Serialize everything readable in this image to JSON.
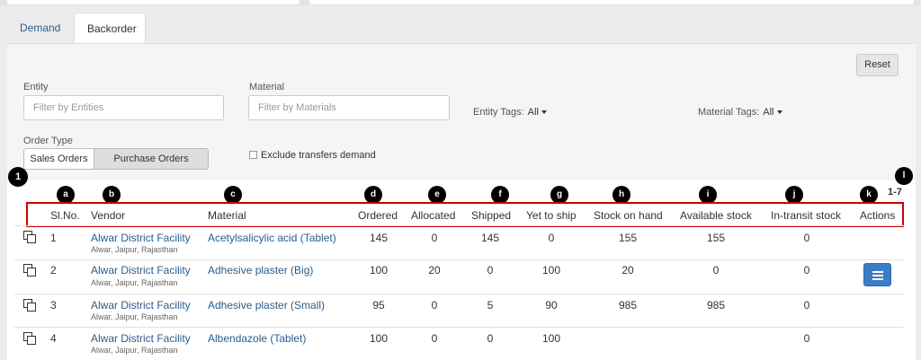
{
  "tabs": [
    {
      "label": "Demand"
    },
    {
      "label": "Backorder"
    }
  ],
  "filters": {
    "reset_label": "Reset",
    "entity_label": "Entity",
    "entity_placeholder": "Filter by Entities",
    "material_label": "Material",
    "material_placeholder": "Filter by Materials",
    "entity_tags_label": "Entity Tags:",
    "entity_tags_value": "All",
    "material_tags_label": "Material Tags:",
    "material_tags_value": "All",
    "order_type_label": "Order Type",
    "order_types": [
      "Sales Orders",
      "Purchase Orders"
    ],
    "exclude_transfers_label": "Exclude transfers demand"
  },
  "pagination": "1-7",
  "callouts": {
    "one": "1",
    "a": "a",
    "b": "b",
    "c": "c",
    "d": "d",
    "e": "e",
    "f": "f",
    "g": "g",
    "h": "h",
    "i": "i",
    "j": "j",
    "k": "k",
    "l": "l"
  },
  "table": {
    "columns": [
      "Sl.No.",
      "Vendor",
      "Material",
      "Ordered",
      "Allocated",
      "Shipped",
      "Yet to ship",
      "Stock on hand",
      "Available stock",
      "In-transit stock",
      "Actions"
    ],
    "rows": [
      {
        "sl": "1",
        "vendor": "Alwar District Facility",
        "location": "Alwar, Jaipur, Rajasthan",
        "material": "Acetylsalicylic acid (Tablet)",
        "ordered": "145",
        "allocated": "0",
        "shipped": "145",
        "yet": "0",
        "soh": "155",
        "avail": "155",
        "transit": "0"
      },
      {
        "sl": "2",
        "vendor": "Alwar District Facility",
        "location": "Alwar, Jaipur, Rajasthan",
        "material": "Adhesive plaster (Big)",
        "ordered": "100",
        "allocated": "20",
        "shipped": "0",
        "yet": "100",
        "soh": "20",
        "avail": "0",
        "transit": "0"
      },
      {
        "sl": "3",
        "vendor": "Alwar District Facility",
        "location": "Alwar, Jaipur, Rajasthan",
        "material": "Adhesive plaster (Small)",
        "ordered": "95",
        "allocated": "0",
        "shipped": "5",
        "yet": "90",
        "soh": "985",
        "avail": "985",
        "transit": "0"
      },
      {
        "sl": "4",
        "vendor": "Alwar District Facility",
        "location": "Alwar, Jaipur, Rajasthan",
        "material": "Albendazole (Tablet)",
        "ordered": "100",
        "allocated": "0",
        "shipped": "0",
        "yet": "100",
        "soh": "",
        "avail": "",
        "transit": "0"
      }
    ]
  },
  "colors": {
    "link": "#2a5e8c",
    "action_button": "#3b7dc4",
    "highlight_border": "#cc0000"
  }
}
